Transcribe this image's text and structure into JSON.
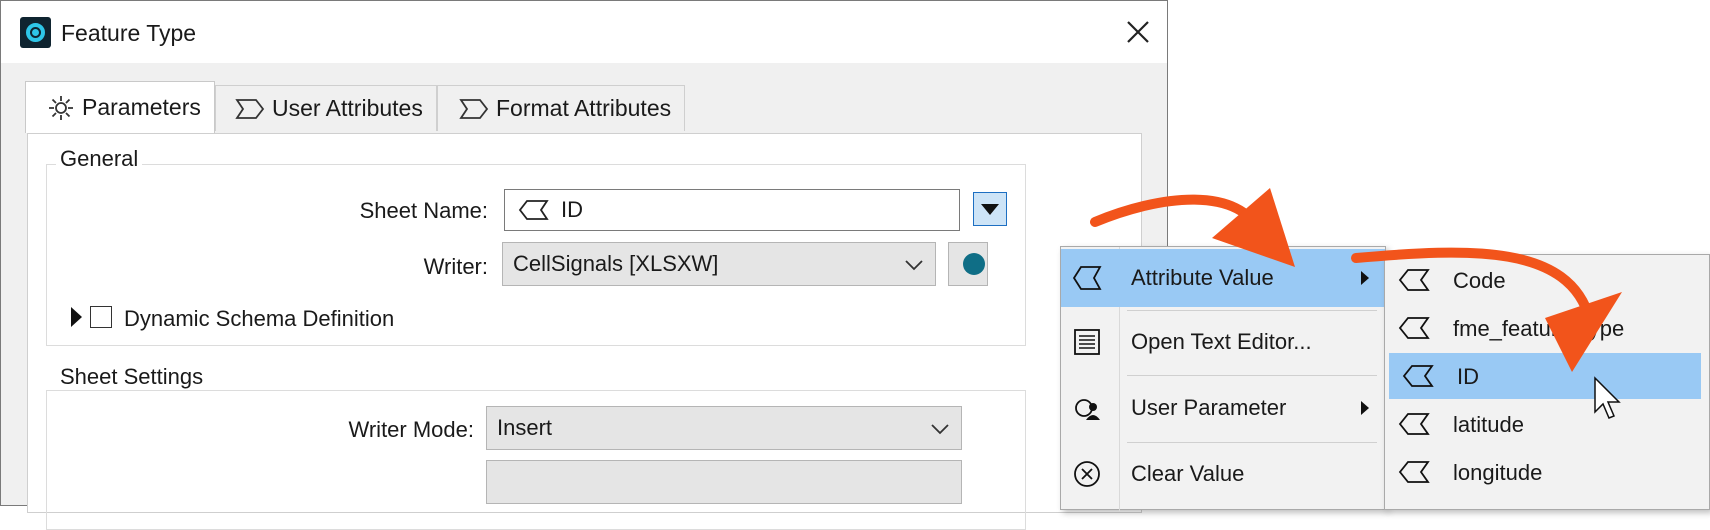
{
  "dialog": {
    "title": "Feature Type",
    "app_icon": "fme-logo-icon",
    "close_icon": "close-icon"
  },
  "tabs": [
    {
      "label": "Parameters",
      "icon": "gear-icon",
      "active": true
    },
    {
      "label": "User Attributes",
      "icon": "attribute-icon",
      "active": false
    },
    {
      "label": "Format Attributes",
      "icon": "attribute-icon",
      "active": false
    }
  ],
  "general": {
    "legend": "General",
    "sheet_name_label": "Sheet Name:",
    "sheet_name_value": "ID",
    "writer_label": "Writer:",
    "writer_value": "CellSignals [XLSXW]",
    "dynamic_schema_label": "Dynamic Schema Definition",
    "dynamic_schema_checked": false
  },
  "sheet_settings": {
    "legend": "Sheet Settings",
    "writer_mode_label": "Writer Mode:",
    "writer_mode_value": "Insert"
  },
  "context_menu": {
    "items": [
      {
        "label": "Attribute Value",
        "icon": "attribute-icon",
        "has_submenu": true,
        "highlighted": true
      },
      {
        "label": "Open Text Editor...",
        "icon": "text-editor-icon",
        "has_submenu": false,
        "highlighted": false
      },
      {
        "label": "User Parameter",
        "icon": "user-parameter-icon",
        "has_submenu": true,
        "highlighted": false
      },
      {
        "label": "Clear Value",
        "icon": "clear-icon",
        "has_submenu": false,
        "highlighted": false
      }
    ]
  },
  "attribute_submenu": {
    "items": [
      {
        "label": "Code",
        "highlighted": false
      },
      {
        "label": "fme_feature_type",
        "highlighted": false
      },
      {
        "label": "ID",
        "highlighted": true
      },
      {
        "label": "latitude",
        "highlighted": false
      },
      {
        "label": "longitude",
        "highlighted": false
      }
    ]
  },
  "colors": {
    "highlight": "#99c9f4",
    "annotation_arrow": "#f2541b",
    "accent": "#2ec6e8"
  }
}
